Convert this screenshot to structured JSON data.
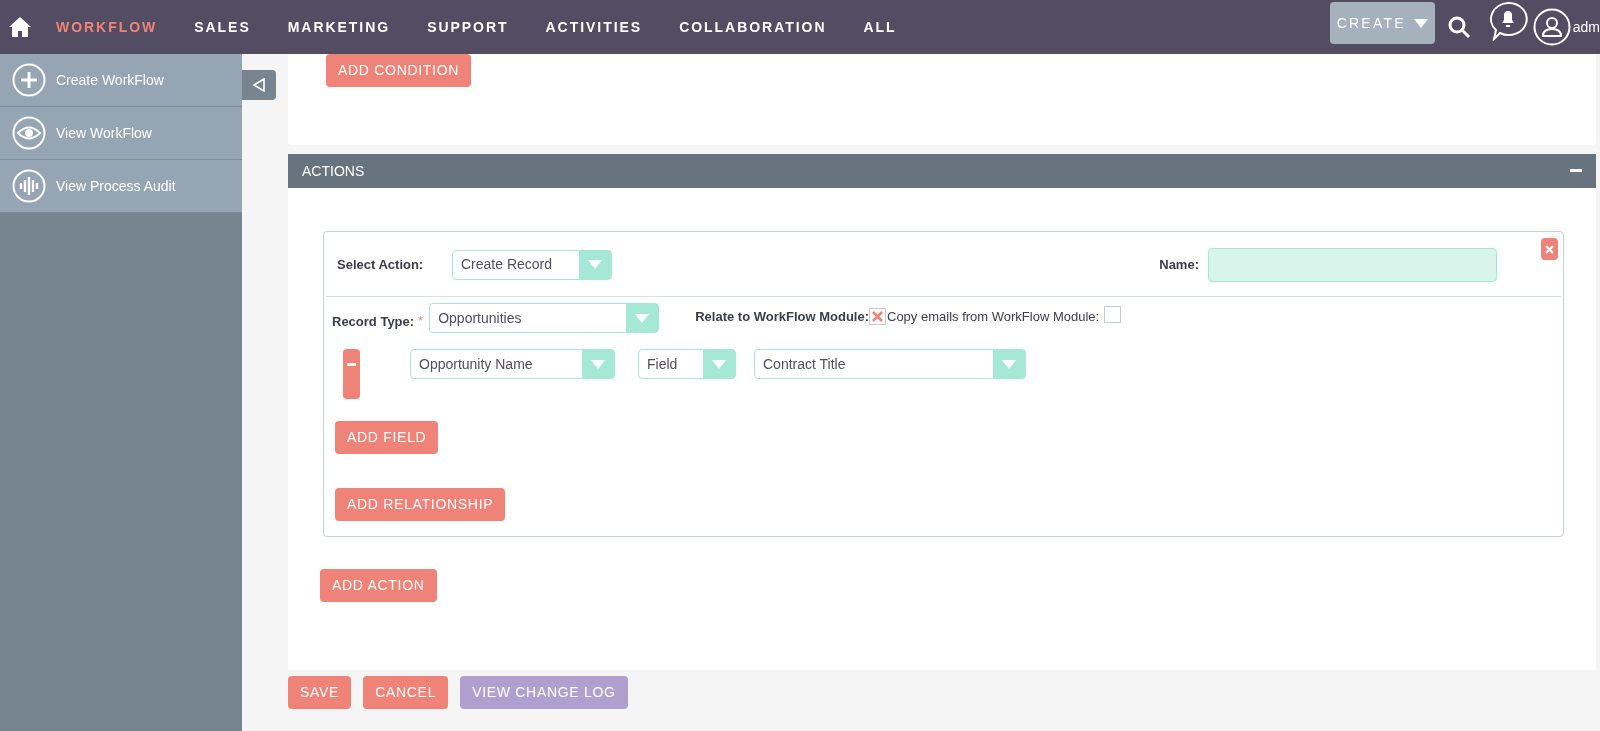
{
  "nav": {
    "tabs": [
      {
        "label": "WORKFLOW",
        "selected": true
      },
      {
        "label": "SALES",
        "selected": false
      },
      {
        "label": "MARKETING",
        "selected": false
      },
      {
        "label": "SUPPORT",
        "selected": false
      },
      {
        "label": "ACTIVITIES",
        "selected": false
      },
      {
        "label": "COLLABORATION",
        "selected": false
      },
      {
        "label": "ALL",
        "selected": false
      }
    ],
    "create_button": "CREATE",
    "user": "adm"
  },
  "sidebar": {
    "items": [
      {
        "label": "Create WorkFlow",
        "kind": "plus"
      },
      {
        "label": "View WorkFlow",
        "kind": "eye"
      },
      {
        "label": "View Process Audit",
        "kind": "audit"
      }
    ]
  },
  "conditions": {
    "add_button": "ADD CONDITION"
  },
  "actions": {
    "title": "ACTIONS",
    "select_action_label": "Select Action:",
    "select_action_value": "Create Record",
    "name_label": "Name:",
    "record_type_label": "Record Type:",
    "required_mark": "*",
    "record_type_value": "Opportunities",
    "relate_label": "Relate to WorkFlow Module:",
    "relate_checked": true,
    "copy_label": "Copy emails from WorkFlow Module:",
    "copy_checked": false,
    "field_row": {
      "field": "Opportunity Name",
      "type": "Field",
      "value": "Contract Title"
    },
    "add_field": "ADD FIELD",
    "add_relationship": "ADD RELATIONSHIP",
    "add_action": "ADD ACTION"
  },
  "footer": {
    "buttons": [
      {
        "label": "SAVE",
        "kind": "primary"
      },
      {
        "label": "CANCEL",
        "kind": "primary"
      },
      {
        "label": "VIEW CHANGE LOG",
        "kind": "secondary"
      }
    ]
  }
}
